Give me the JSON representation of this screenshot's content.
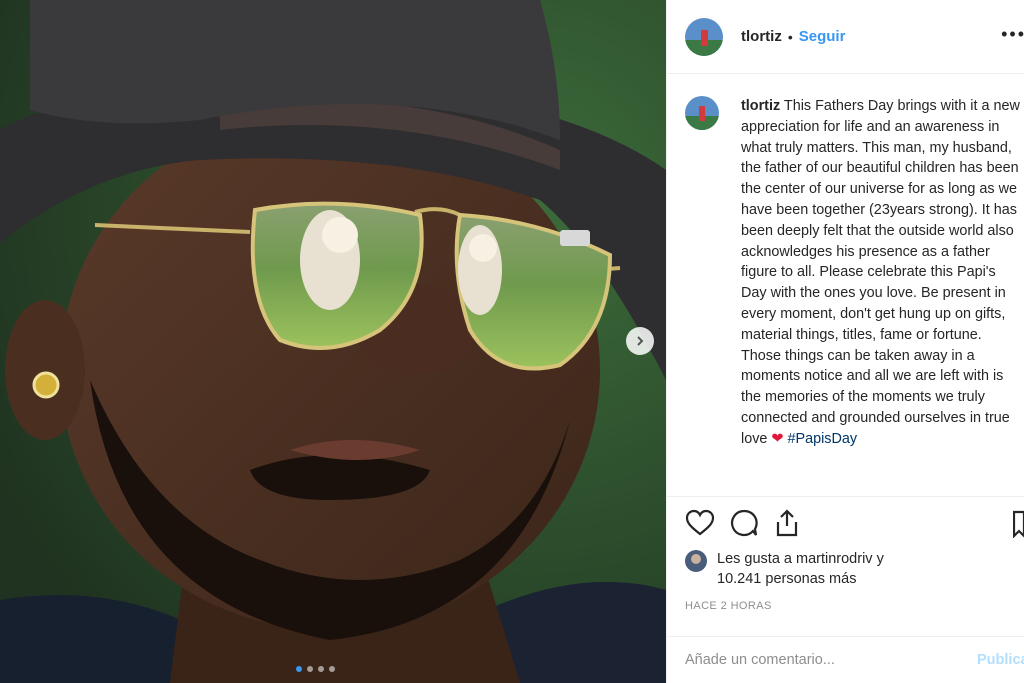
{
  "post": {
    "username": "tlortiz",
    "separator": "•",
    "follow_label": "Seguir",
    "more_label": "•••",
    "caption_user": "tlortiz",
    "caption_text": "This Fathers Day brings with it a new appreciation for life and an awareness in what truly matters. This man, my husband, the father of our beautiful children has been the center of our universe for as long as we have been together (23years strong). It has been deeply felt that the outside world also acknowledges his presence as a father figure to all. Please celebrate this Papi's Day with the ones you love. Be present in every moment, don't get hung up on gifts, material things, titles, fame or fortune. Those things can be taken away in a moments notice and all we are left with is the memories of the moments we truly connected and grounded ourselves in true love",
    "caption_heart": "❤",
    "caption_hashtag": "#PapisDay",
    "likes_line1": "Les gusta a martinrodriv y",
    "likes_line2": "10.241 personas más",
    "timestamp": "HACE 2 HORAS",
    "comment_placeholder": "Añade un comentario...",
    "publish_label": "Publicar",
    "carousel_count": 4,
    "carousel_active_index": 0
  },
  "icons": {
    "like": "heart-outline-icon",
    "comment": "comment-bubble-icon",
    "share": "share-upload-icon",
    "save": "bookmark-icon",
    "next": "chevron-right-icon"
  },
  "colors": {
    "link_blue": "#3897f0",
    "publish_disabled": "#b2dffc",
    "meta_gray": "#8e8e8e",
    "heart_red": "#e0173a"
  }
}
